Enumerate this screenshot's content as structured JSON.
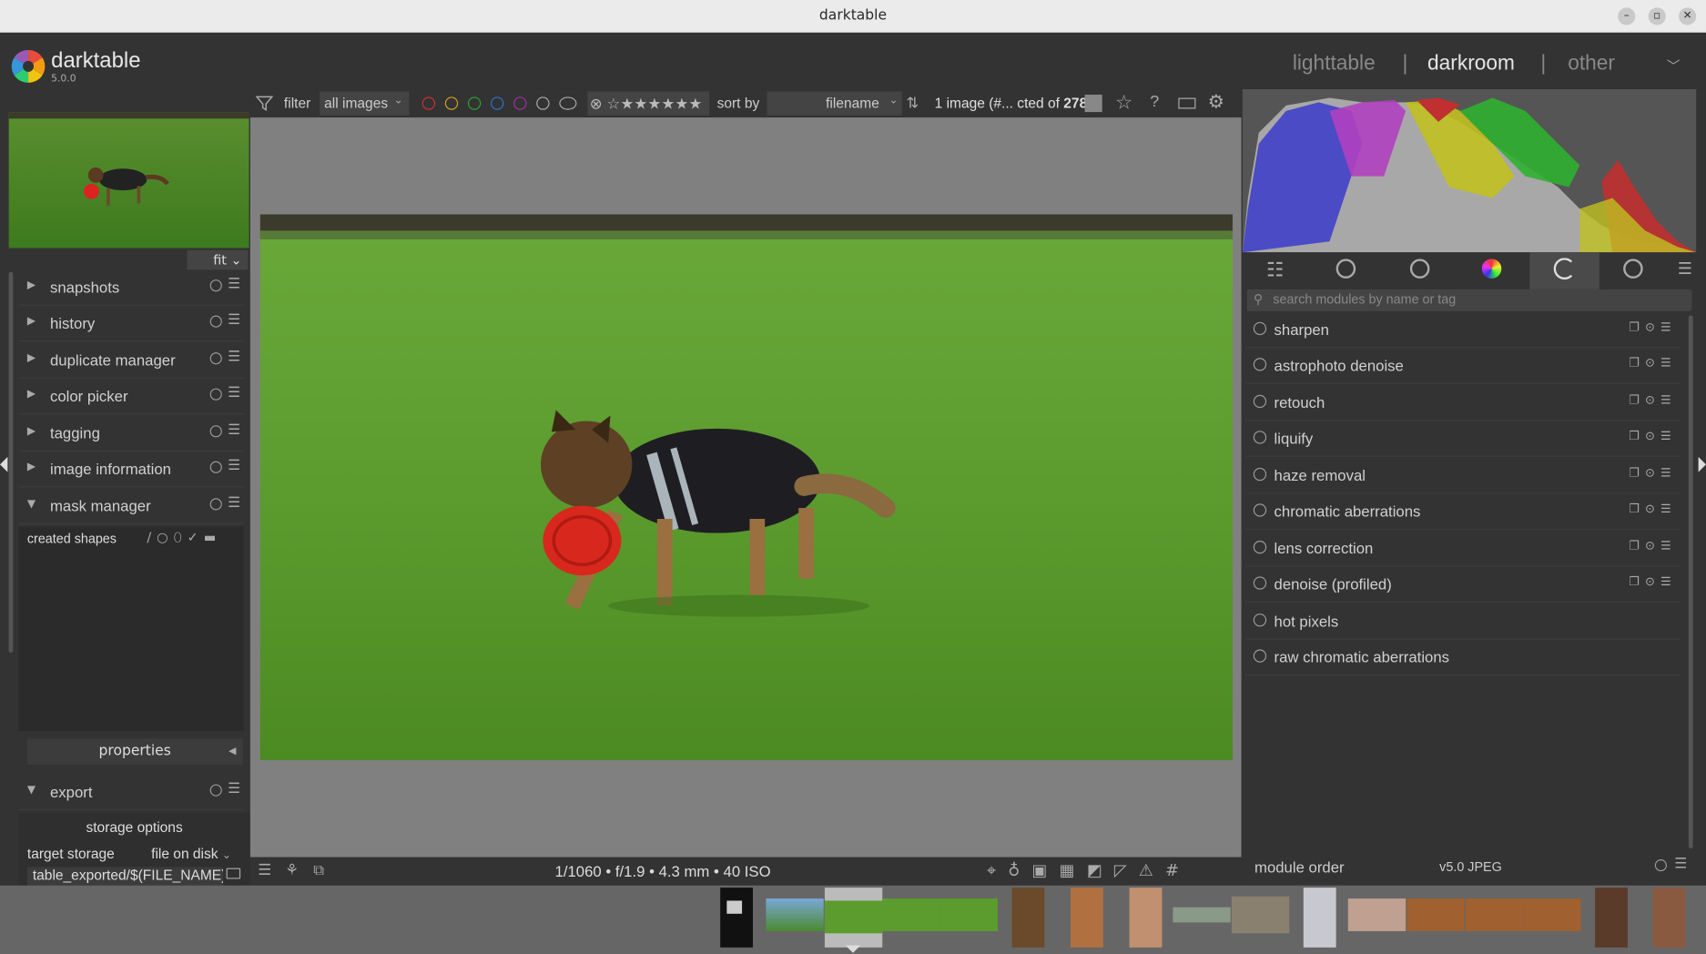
{
  "window": {
    "title": "darktable"
  },
  "app": {
    "name": "darktable",
    "version": "5.0.0"
  },
  "views": {
    "lighttable": "lighttable",
    "darkroom": "darkroom",
    "other": "other",
    "sep": "|"
  },
  "filterbar": {
    "filter_label": "filter",
    "filter_value": "all images",
    "sort_label": "sort by",
    "sort_value": "filename",
    "count_text": "1 image (#... cted of",
    "count_total": "278"
  },
  "left_panel": {
    "zoom": "fit",
    "modules": [
      {
        "label": "snapshots",
        "expanded": false
      },
      {
        "label": "history",
        "expanded": false
      },
      {
        "label": "duplicate manager",
        "expanded": false
      },
      {
        "label": "color picker",
        "expanded": false
      },
      {
        "label": "tagging",
        "expanded": false
      },
      {
        "label": "image information",
        "expanded": false
      },
      {
        "label": "mask manager",
        "expanded": true
      }
    ],
    "mask_manager": {
      "created_shapes": "created shapes",
      "properties": "properties"
    },
    "export": {
      "label": "export",
      "storage_options": "storage options",
      "target_storage_label": "target storage",
      "target_storage_value": "file on disk",
      "path": "table_exported/$(FILE_NAME)"
    }
  },
  "center": {
    "exif": "1/1060 • f/1.9 • 4.3 mm • 40 ISO"
  },
  "right_panel": {
    "search_placeholder": "search modules by name or tag",
    "modules": [
      {
        "label": "sharpen",
        "enabled": true
      },
      {
        "label": "astrophoto denoise",
        "enabled": true
      },
      {
        "label": "retouch",
        "enabled": true
      },
      {
        "label": "liquify",
        "enabled": true
      },
      {
        "label": "haze removal",
        "enabled": true
      },
      {
        "label": "chromatic aberrations",
        "enabled": true
      },
      {
        "label": "lens correction",
        "enabled": true
      },
      {
        "label": "denoise (profiled)",
        "enabled": true
      },
      {
        "label": "hot pixels",
        "enabled": false
      },
      {
        "label": "raw chromatic aberrations",
        "enabled": false
      }
    ],
    "module_order_label": "module order",
    "module_order_value": "v5.0 JPEG"
  },
  "colors": {
    "bg": "#333333",
    "center": "#808080",
    "filmstrip": "#666666",
    "text": "#d0d0d0"
  },
  "icons": [
    "filter-icon",
    "star-icon",
    "help-icon",
    "keyboard-icon",
    "gear-icon",
    "power-icon",
    "search-icon",
    "menu-icon"
  ]
}
